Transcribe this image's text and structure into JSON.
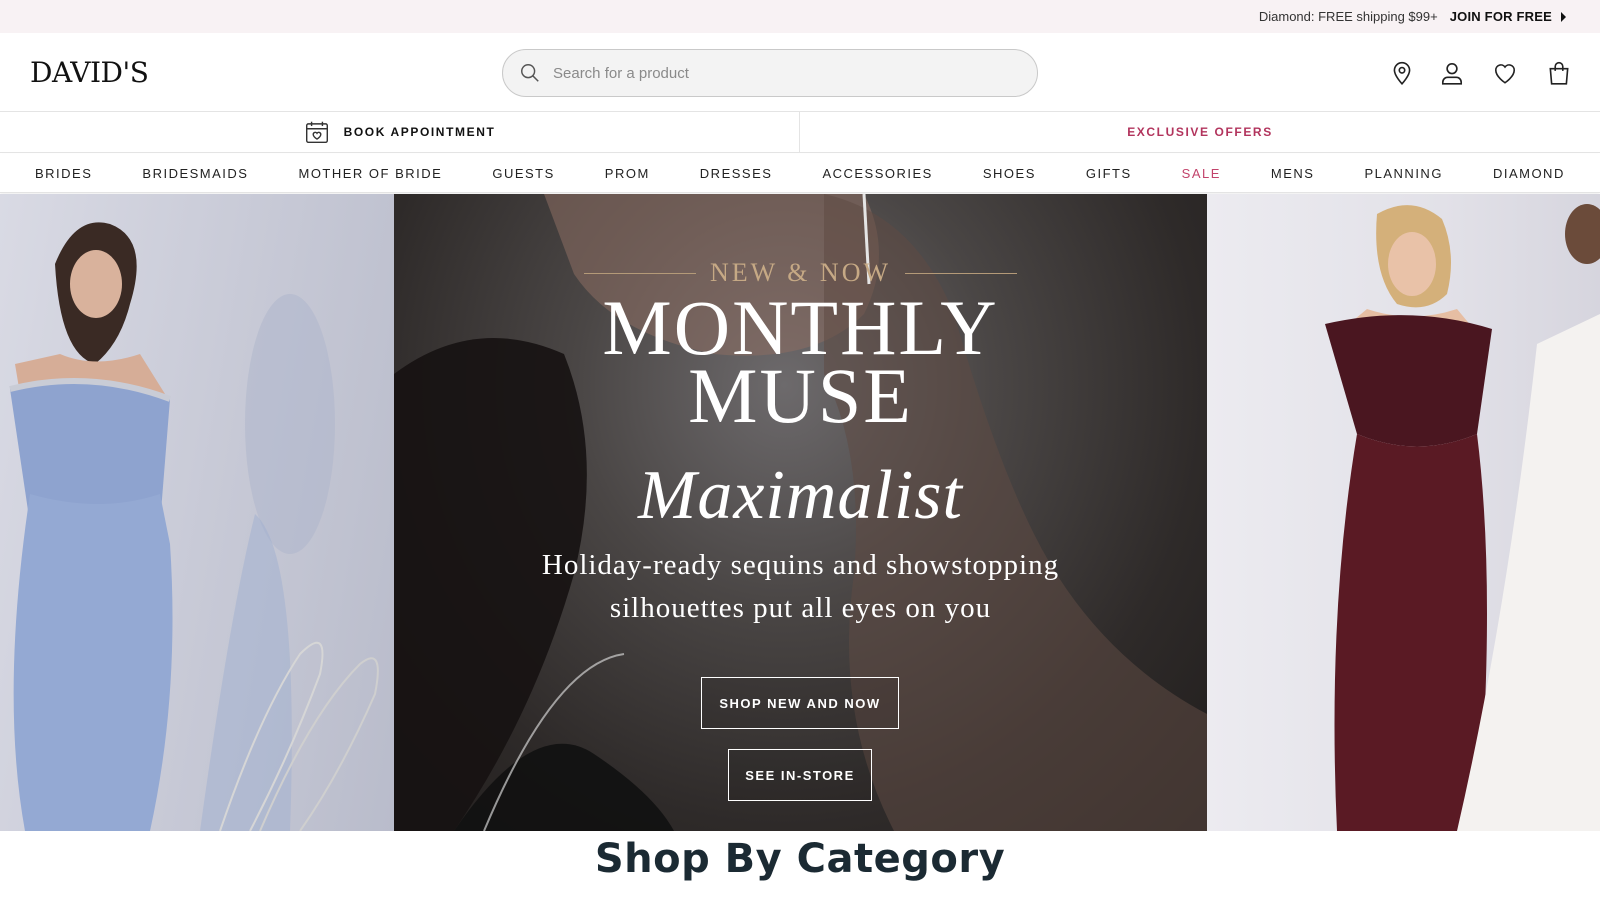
{
  "promo": {
    "text": "Diamond: FREE shipping $99+",
    "join_label": "JOIN FOR FREE"
  },
  "header": {
    "logo": "DAVID'S",
    "search_placeholder": "Search for a product",
    "icons": [
      "location-pin-icon",
      "account-icon",
      "wishlist-heart-icon",
      "shopping-bag-icon"
    ]
  },
  "subbar": {
    "book_label": "BOOK APPOINTMENT",
    "offers_label": "EXCLUSIVE OFFERS"
  },
  "nav": {
    "items": [
      "BRIDES",
      "BRIDESMAIDS",
      "MOTHER OF BRIDE",
      "GUESTS",
      "PROM",
      "DRESSES",
      "ACCESSORIES",
      "SHOES",
      "GIFTS",
      "SALE",
      "MENS",
      "PLANNING",
      "DIAMOND"
    ]
  },
  "hero": {
    "kicker": "NEW & NOW",
    "title_line1": "MONTHLY",
    "title_line2": "MUSE",
    "italic_title": "Maximalist",
    "subtitle_line1": "Holiday-ready sequins and showstopping",
    "subtitle_line2": "silhouettes put all eyes on you",
    "primary_cta": "SHOP NEW AND NOW",
    "secondary_cta": "SEE IN-STORE"
  },
  "section": {
    "heading": "Shop By Category"
  },
  "colors": {
    "promo_bg": "#f8f2f4",
    "accent_pink": "#b2345d",
    "sale_pink": "#c2436b",
    "kicker_gold": "#c6a985",
    "heading": "#1b2a33"
  }
}
